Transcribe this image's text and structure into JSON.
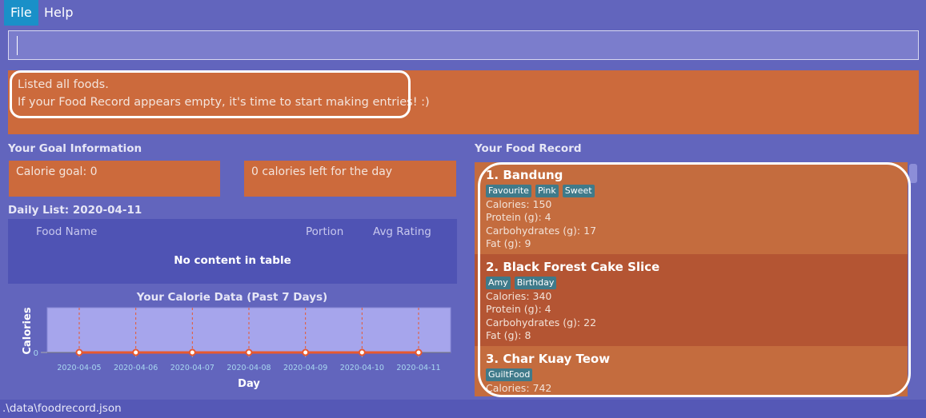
{
  "menu": {
    "file": "File",
    "help": "Help"
  },
  "command": {
    "value": ""
  },
  "result": {
    "lines": [
      "Listed all foods.",
      "If your Food Record appears empty, it's time to start making entries! :)"
    ]
  },
  "goal": {
    "header": "Your Goal Information",
    "calorie_goal": "Calorie goal: 0",
    "calories_left": "0 calories left for the day"
  },
  "daily": {
    "header": "Daily List: 2020-04-11",
    "columns": [
      "Food Name",
      "Portion",
      "Avg Rating"
    ],
    "empty": "No content in table"
  },
  "chart_data": {
    "type": "line",
    "title": "Your Calorie Data (Past 7 Days)",
    "xlabel": "Day",
    "ylabel": "Calories",
    "categories": [
      "2020-04-05",
      "2020-04-06",
      "2020-04-07",
      "2020-04-08",
      "2020-04-09",
      "2020-04-10",
      "2020-04-11"
    ],
    "values": [
      0,
      0,
      0,
      0,
      0,
      0,
      0
    ],
    "yticks": [
      "0"
    ],
    "grid": "vertical dashed",
    "colors": {
      "line": "#e8582e",
      "plot_bg": "#a6a5ec"
    }
  },
  "record": {
    "header": "Your Food Record",
    "items": [
      {
        "title": "1.  Bandung",
        "tags": [
          "Favourite",
          "Pink",
          "Sweet"
        ],
        "lines": [
          "Calories: 150",
          "Protein (g): 4",
          "Carbohydrates (g): 17",
          "Fat (g): 9"
        ]
      },
      {
        "title": "2.  Black Forest Cake Slice",
        "tags": [
          "Amy",
          "Birthday"
        ],
        "lines": [
          "Calories: 340",
          "Protein (g): 4",
          "Carbohydrates (g): 22",
          "Fat (g): 8"
        ]
      },
      {
        "title": "3.  Char Kuay Teow",
        "tags": [
          "GuiltFood"
        ],
        "lines": [
          "Calories: 742"
        ]
      }
    ]
  },
  "status": {
    "path": ".\\data\\foodrecord.json"
  }
}
